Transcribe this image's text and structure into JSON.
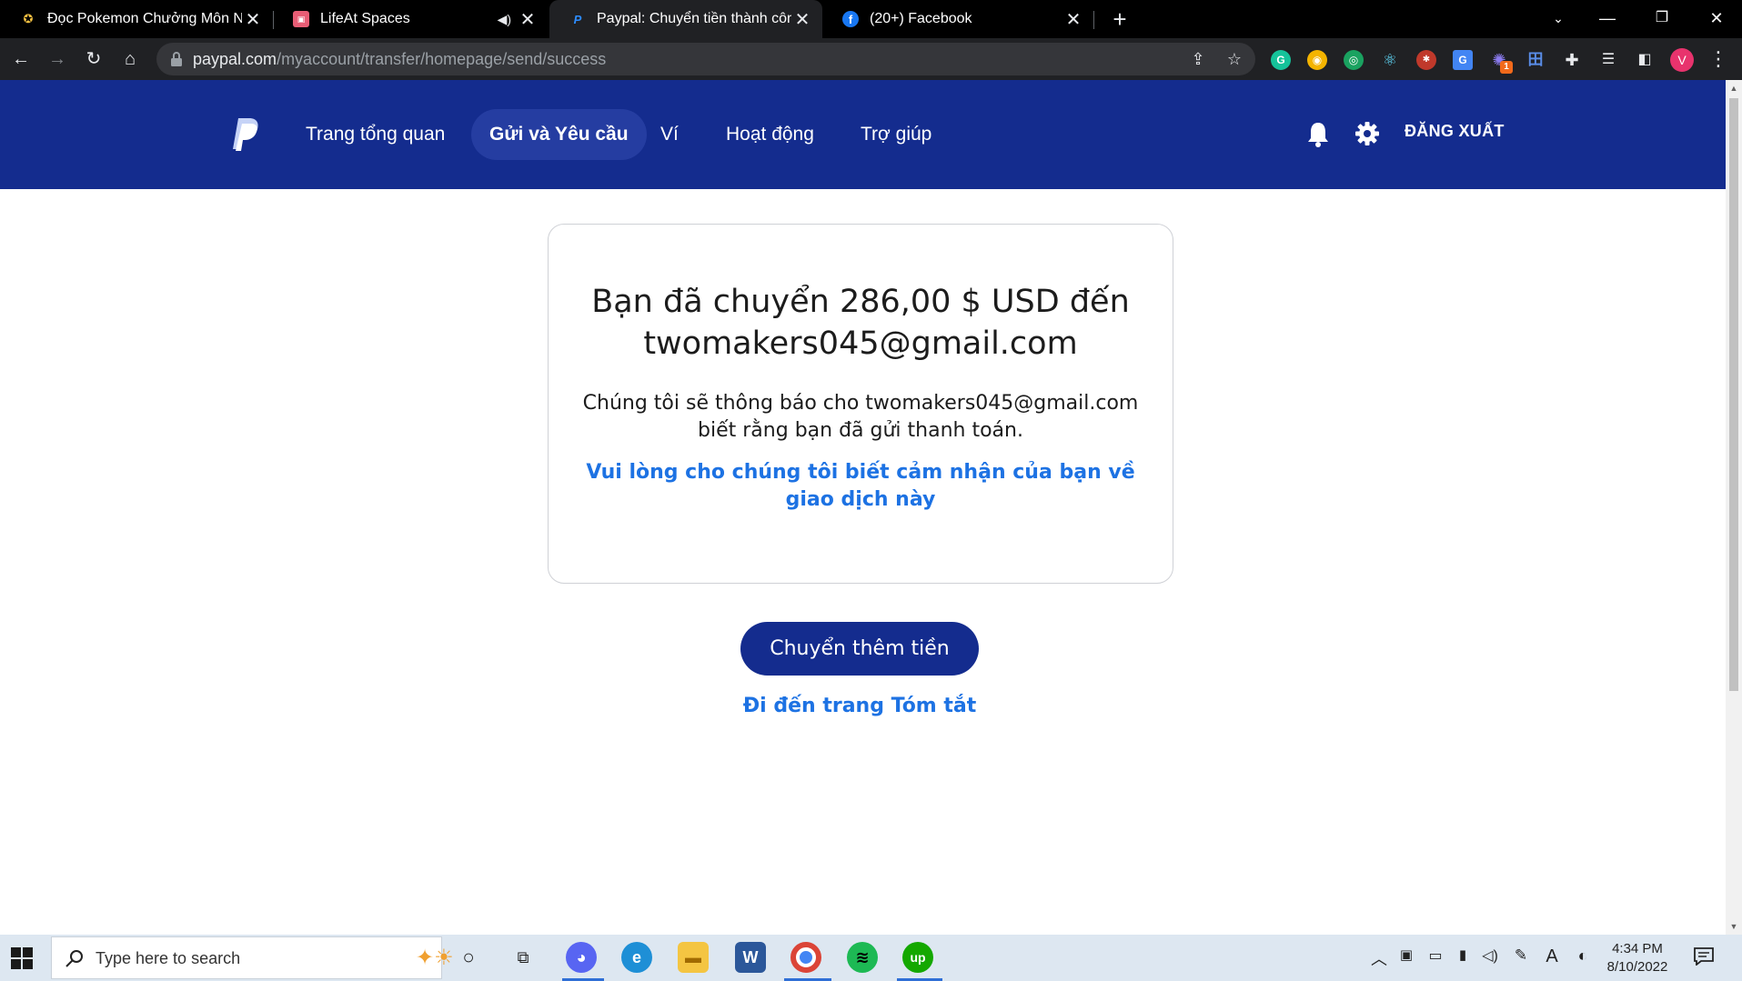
{
  "browser": {
    "tabs": [
      {
        "title": "Đọc Pokemon Chưởng Môn Nhân",
        "favicon": "pokemon-icon",
        "active": false
      },
      {
        "title": "LifeAt Spaces",
        "favicon": "lifeat-icon",
        "active": false,
        "audio": true
      },
      {
        "title": "Paypal: Chuyển tiền thành công",
        "favicon": "paypal-icon",
        "active": true
      },
      {
        "title": "(20+) Facebook",
        "favicon": "facebook-icon",
        "active": false
      }
    ],
    "url_host": "paypal.com",
    "url_path": "/myaccount/transfer/homepage/send/success",
    "profile_initial": "V",
    "extension_badge": "1"
  },
  "paypal": {
    "nav": {
      "overview": "Trang tổng quan",
      "send_request": "Gửi và Yêu cầu",
      "wallet": "Ví",
      "activity": "Hoạt động",
      "help": "Trợ giúp",
      "logout": "ĐĂNG XUẤT"
    },
    "card": {
      "title_line1": "Bạn đã chuyển 286,00 $ USD đến",
      "title_line2": "twomakers045@gmail.com",
      "message_line1": "Chúng tôi sẽ thông báo cho twomakers045@gmail.com",
      "message_line2": "biết rằng bạn đã gửi thanh toán.",
      "feedback_line1": "Vui lòng cho chúng tôi biết cảm nhận của bạn về",
      "feedback_line2": "giao dịch này"
    },
    "send_more_label": "Chuyển thêm tiền",
    "summary_link": "Đi đến trang Tóm tắt",
    "colors": {
      "header": "#142c8e",
      "active_nav": "#253da1",
      "link": "#1d72e3"
    }
  },
  "taskbar": {
    "search_placeholder": "Type here to search",
    "time": "4:34 PM",
    "date": "8/10/2022",
    "language_indicator": "A"
  }
}
